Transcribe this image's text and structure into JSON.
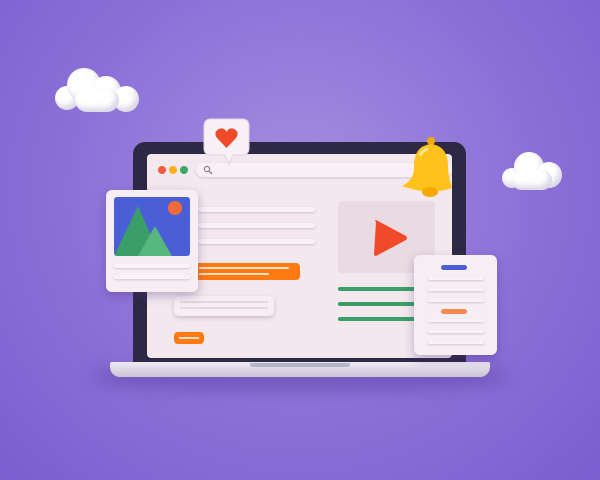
{
  "illustration": {
    "icons": [
      "cloud-icon",
      "heart-icon",
      "speech-bubble-icon",
      "bell-icon",
      "search-icon",
      "play-icon",
      "image-mountain-icon",
      "sun-icon"
    ],
    "window_controls": [
      "close",
      "minimize",
      "maximize"
    ]
  },
  "colors": {
    "background": "#8c70d8",
    "bezel": "#2d2846",
    "screen": "#f3e8ee",
    "accent_orange": "#ff7a10",
    "accent_green": "#3a9e68",
    "accent_blue": "#4a5fd6",
    "play_red": "#f04a2a",
    "bell_yellow": "#ffc21c",
    "dot_red": "#f05a3a",
    "dot_yellow": "#f8b21c",
    "dot_green": "#3aaa66"
  }
}
